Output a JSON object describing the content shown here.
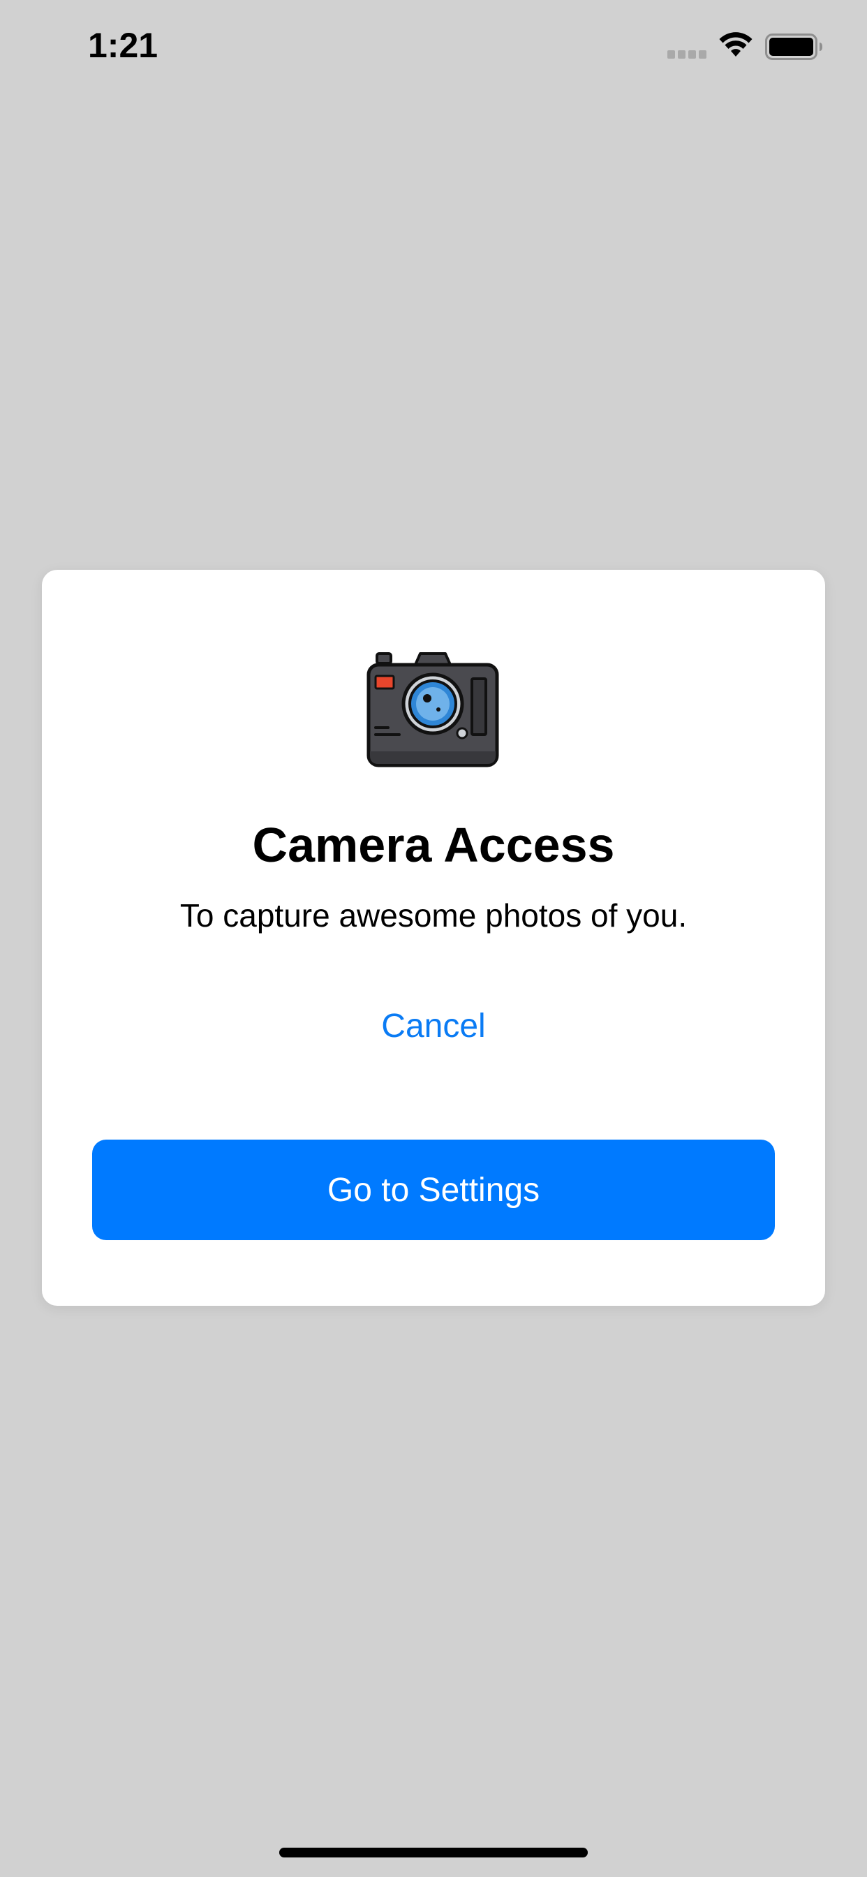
{
  "status_bar": {
    "time": "1:21",
    "icons": [
      "cellular-signal-icon",
      "wifi-icon",
      "battery-icon"
    ]
  },
  "dialog": {
    "icon": "camera-icon",
    "title": "Camera Access",
    "subtitle": "To capture awesome photos of you.",
    "cancel_label": "Cancel",
    "settings_label": "Go to Settings"
  },
  "colors": {
    "background": "#d1d1d1",
    "dialog_background": "#ffffff",
    "accent": "#007aff",
    "cancel_text": "#0a7bf4",
    "camera_body": "#4a4a4f",
    "camera_lens": "#2f86d6",
    "camera_indicator": "#e8462c"
  }
}
